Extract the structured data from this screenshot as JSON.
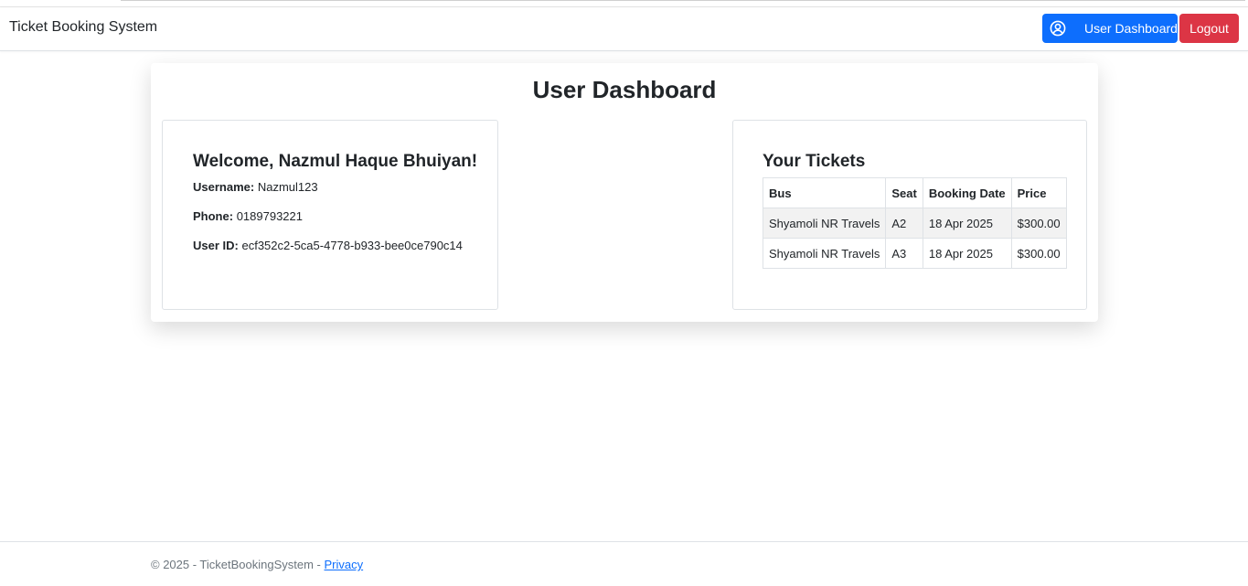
{
  "navbar": {
    "brand": "Ticket Booking System",
    "dashboard_button": "User Dashboard",
    "logout_button": "Logout"
  },
  "page": {
    "title": "User Dashboard"
  },
  "profile": {
    "welcome": "Welcome, Nazmul Haque Bhuiyan!",
    "username_label": "Username:",
    "username": "Nazmul123",
    "phone_label": "Phone:",
    "phone": "0189793221",
    "userid_label": "User ID:",
    "userid": "ecf352c2-5ca5-4778-b933-bee0ce790c14"
  },
  "tickets": {
    "title": "Your Tickets",
    "columns": [
      "Bus",
      "Seat",
      "Booking Date",
      "Price"
    ],
    "rows": [
      [
        "Shyamoli NR Travels",
        "A2",
        "18 Apr 2025",
        "$300.00"
      ],
      [
        "Shyamoli NR Travels",
        "A3",
        "18 Apr 2025",
        "$300.00"
      ]
    ]
  },
  "footer": {
    "copyright": "© 2025 - TicketBookingSystem - ",
    "privacy_link": "Privacy"
  },
  "icons": {
    "dashboard": "user-circle-icon"
  },
  "colors": {
    "primary": "#0d6efd",
    "danger": "#dc3545"
  }
}
